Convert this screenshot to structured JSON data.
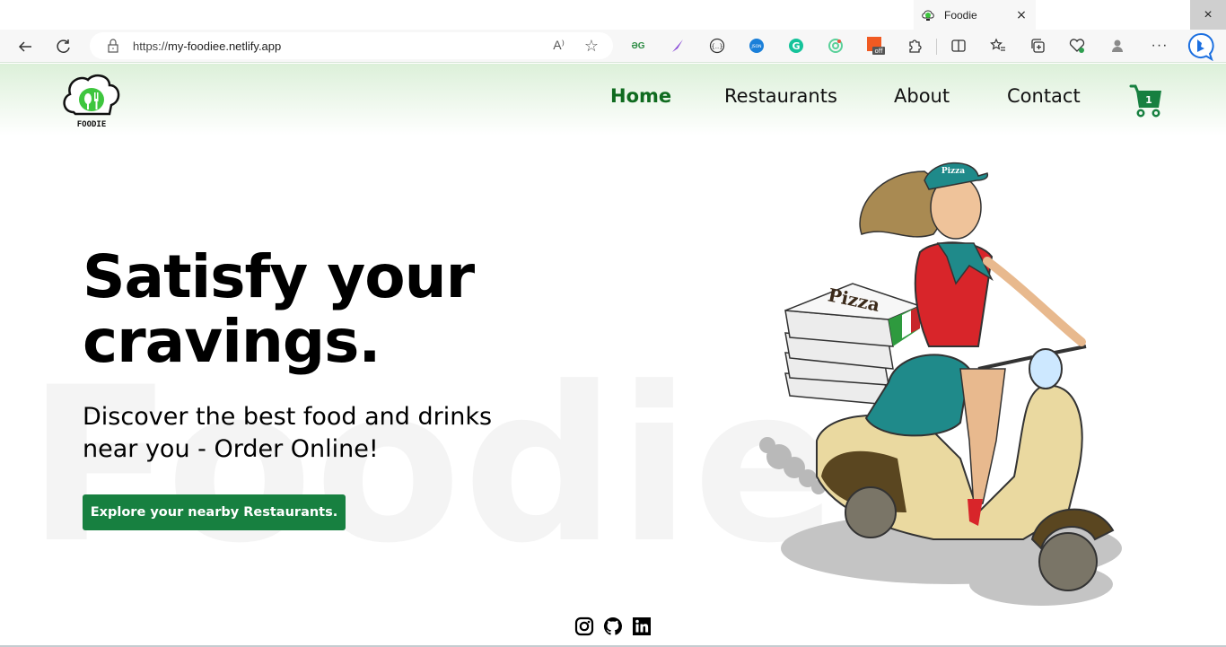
{
  "browser": {
    "tab": {
      "title": "Foodie",
      "close_label": "×"
    },
    "window_close_label": "×",
    "address_bar": {
      "scheme": "https://",
      "host": "my-foodiee.netlify.app",
      "read_aloud_label": "A⁾"
    },
    "toolbar_icons": [
      "back-icon",
      "refresh-icon",
      "lock-icon",
      "read-aloud-icon",
      "favorite-star-icon",
      "geeksforgeeks-extension-icon",
      "quill-extension-icon",
      "json-formatter-extension-icon",
      "json-extension-icon",
      "grammarly-extension-icon",
      "radar-extension-icon",
      "coupon-extension-icon",
      "extensions-puzzle-icon",
      "split-screen-icon",
      "favorites-icon",
      "collections-icon",
      "browser-essentials-icon",
      "profile-icon",
      "more-menu-icon",
      "bing-chat-icon"
    ],
    "extension_badge": "off"
  },
  "site": {
    "logo_text": "FOODIE",
    "nav": [
      {
        "label": "Home",
        "active": true
      },
      {
        "label": "Restaurants",
        "active": false
      },
      {
        "label": "About",
        "active": false
      },
      {
        "label": "Contact",
        "active": false
      }
    ],
    "cart_count": "1",
    "watermark": "Foodie",
    "hero": {
      "title": "Satisfy your cravings.",
      "subtitle": "Discover the best food and drinks near you - Order Online!",
      "cta_label": "Explore your nearby Restaurants."
    },
    "illustration": {
      "box_label": "Pizza",
      "cap_label": "Pizza"
    },
    "social": [
      "instagram-icon",
      "github-icon",
      "linkedin-icon"
    ],
    "colors": {
      "brand_green": "#178040",
      "nav_active": "#0f6b1f",
      "nav_gradient_top": "#dcf0d9"
    }
  }
}
